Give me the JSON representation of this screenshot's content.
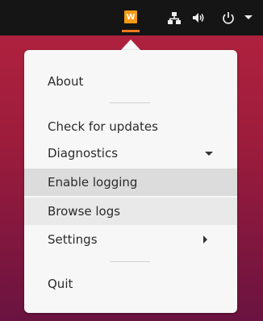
{
  "tray": {
    "app_badge": "W",
    "icons": [
      "network-icon",
      "volume-icon",
      "power-icon",
      "chevron-down-icon"
    ]
  },
  "menu": {
    "about": "About",
    "check_updates": "Check for updates",
    "diagnostics": "Diagnostics",
    "enable_logging": "Enable logging",
    "browse_logs": "Browse logs",
    "settings": "Settings",
    "quit": "Quit"
  },
  "colors": {
    "topbar": "#151515",
    "badge": "#f29a16",
    "menu_bg": "#f7f7f7",
    "highlight": "#dcdcdc"
  }
}
